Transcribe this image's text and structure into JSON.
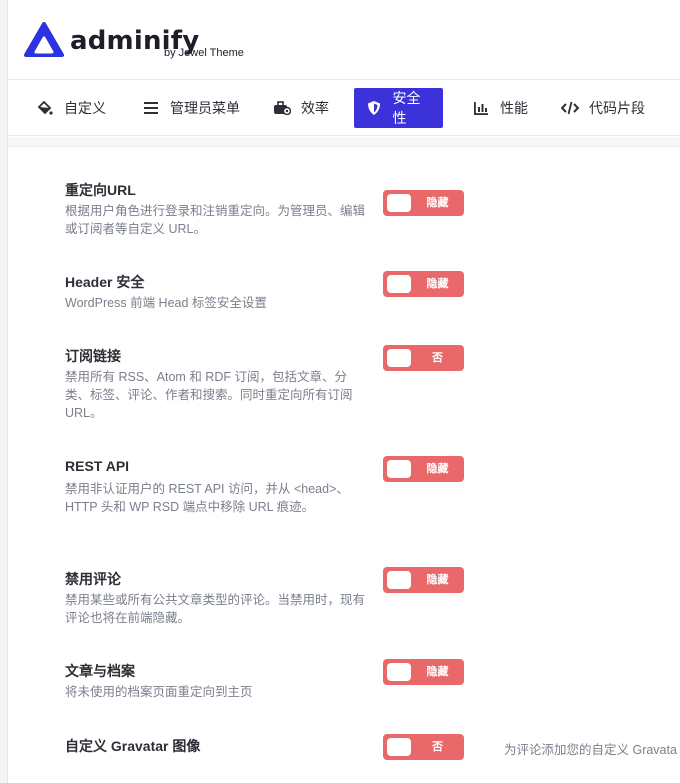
{
  "brand": {
    "name": "adminify",
    "by": "by Jewel Theme"
  },
  "colors": {
    "accent": "#3b33d9",
    "toggle_off": "#e9686a"
  },
  "tabs": [
    {
      "label": "自定义",
      "icon": "paint-bucket-icon",
      "active": false
    },
    {
      "label": "管理员菜单",
      "icon": "menu-lines-icon",
      "active": false
    },
    {
      "label": "效率",
      "icon": "toolbox-icon",
      "active": false
    },
    {
      "label": "安全性",
      "icon": "shield-icon",
      "active": true
    },
    {
      "label": "性能",
      "icon": "bar-chart-icon",
      "active": false
    },
    {
      "label": "代码片段",
      "icon": "code-icon",
      "active": false
    }
  ],
  "settings": [
    {
      "title": "重定向URL",
      "desc": "根据用户角色进行登录和注销重定向。为管理员、编辑或订阅者等自定义 URL。",
      "toggle": "隐藏"
    },
    {
      "title": "Header 安全",
      "desc": "WordPress 前端 Head 标签安全设置",
      "toggle": "隐藏"
    },
    {
      "title": "订阅链接",
      "desc": "禁用所有 RSS、Atom 和 RDF 订阅，包括文章、分类、标签、评论、作者和搜索。同时重定向所有订阅 URL。",
      "toggle": "否"
    },
    {
      "title": "REST API",
      "desc": "禁用非认证用户的 REST API 访问，并从 <head>、HTTP 头和 WP RSD 端点中移除 URL 痕迹。",
      "toggle": "隐藏"
    },
    {
      "title": "禁用评论",
      "desc": "禁用某些或所有公共文章类型的评论。当禁用时，现有评论也将在前端隐藏。",
      "toggle": "隐藏"
    },
    {
      "title": "文章与档案",
      "desc": "将未使用的档案页面重定向到主页",
      "toggle": "隐藏"
    },
    {
      "title": "自定义 Gravatar 图像",
      "desc": "",
      "toggle": "否",
      "note": "为评论添加您的自定义 Gravata"
    }
  ]
}
